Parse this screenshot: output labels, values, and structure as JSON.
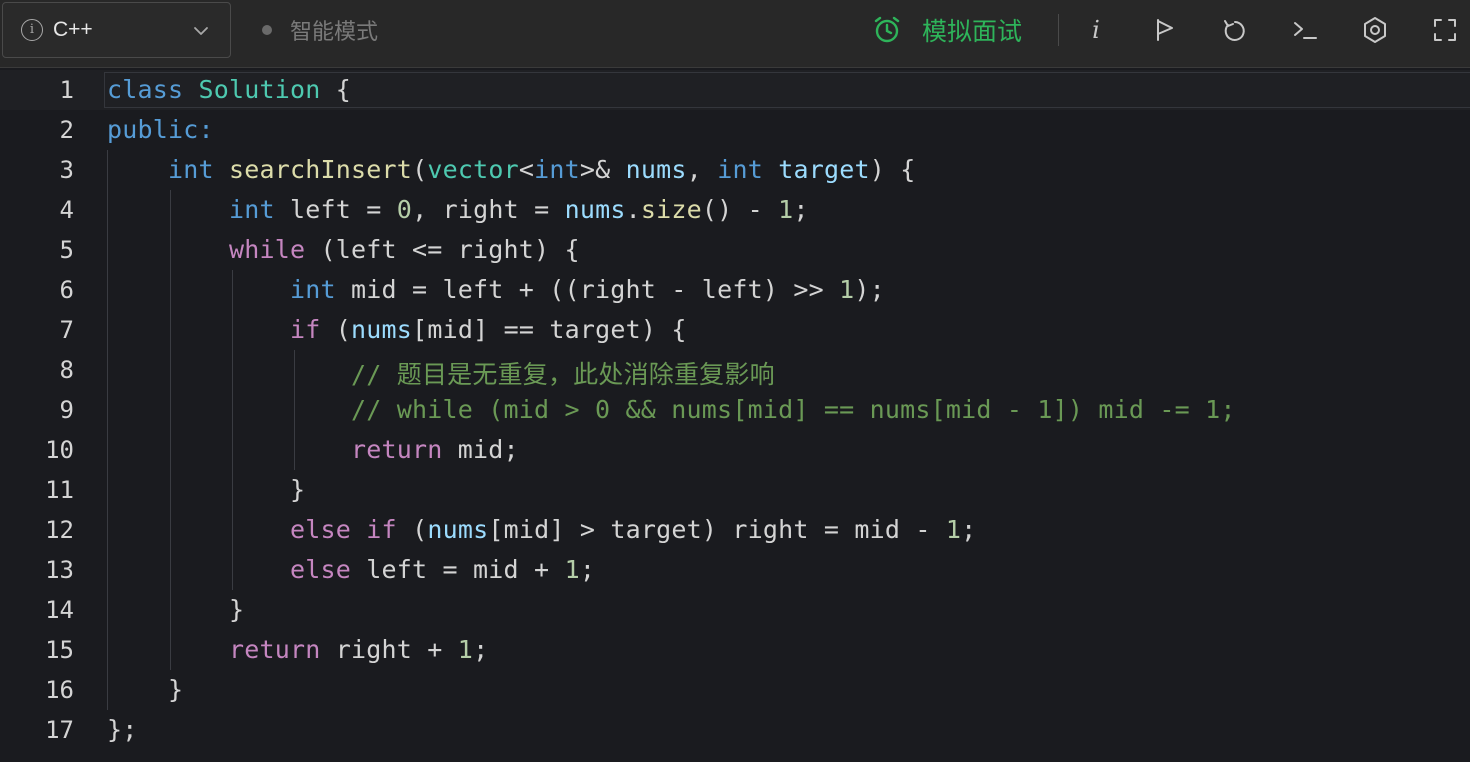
{
  "toolbar": {
    "language": "C++",
    "mode_label": "智能模式",
    "interview_label": "模拟面试",
    "accent_color": "#2eb45a",
    "icons": [
      "info-circle-icon",
      "chevron-down-icon",
      "alarm-clock-icon",
      "info-icon",
      "flag-icon",
      "reset-icon",
      "terminal-icon",
      "gear-icon",
      "fullscreen-icon"
    ]
  },
  "editor": {
    "active_line": 1,
    "lines": [
      {
        "n": "1",
        "tokens": [
          {
            "t": "class",
            "c": "kw"
          },
          {
            "t": " ",
            "c": "pl"
          },
          {
            "t": "Solution",
            "c": "ty"
          },
          {
            "t": " {",
            "c": "pl"
          }
        ]
      },
      {
        "n": "2",
        "tokens": [
          {
            "t": "public:",
            "c": "kw"
          }
        ]
      },
      {
        "n": "3",
        "tokens": [
          {
            "t": "    ",
            "c": "pl"
          },
          {
            "t": "int",
            "c": "kw"
          },
          {
            "t": " ",
            "c": "pl"
          },
          {
            "t": "searchInsert",
            "c": "fn"
          },
          {
            "t": "(",
            "c": "pl"
          },
          {
            "t": "vector",
            "c": "ty"
          },
          {
            "t": "<",
            "c": "pl"
          },
          {
            "t": "int",
            "c": "kw"
          },
          {
            "t": ">&",
            "c": "pl"
          },
          {
            "t": " ",
            "c": "pl"
          },
          {
            "t": "nums",
            "c": "var"
          },
          {
            "t": ", ",
            "c": "pl"
          },
          {
            "t": "int",
            "c": "kw"
          },
          {
            "t": " ",
            "c": "pl"
          },
          {
            "t": "target",
            "c": "var"
          },
          {
            "t": ") {",
            "c": "pl"
          }
        ]
      },
      {
        "n": "4",
        "tokens": [
          {
            "t": "        ",
            "c": "pl"
          },
          {
            "t": "int",
            "c": "kw"
          },
          {
            "t": " left = ",
            "c": "pl"
          },
          {
            "t": "0",
            "c": "num"
          },
          {
            "t": ", right = ",
            "c": "pl"
          },
          {
            "t": "nums",
            "c": "var"
          },
          {
            "t": ".",
            "c": "pl"
          },
          {
            "t": "size",
            "c": "fn"
          },
          {
            "t": "() - ",
            "c": "pl"
          },
          {
            "t": "1",
            "c": "num"
          },
          {
            "t": ";",
            "c": "pl"
          }
        ]
      },
      {
        "n": "5",
        "tokens": [
          {
            "t": "        ",
            "c": "pl"
          },
          {
            "t": "while",
            "c": "ctl"
          },
          {
            "t": " (left <= right) {",
            "c": "pl"
          }
        ]
      },
      {
        "n": "6",
        "tokens": [
          {
            "t": "            ",
            "c": "pl"
          },
          {
            "t": "int",
            "c": "kw"
          },
          {
            "t": " mid = left + ((right - left) >> ",
            "c": "pl"
          },
          {
            "t": "1",
            "c": "num"
          },
          {
            "t": ");",
            "c": "pl"
          }
        ]
      },
      {
        "n": "7",
        "tokens": [
          {
            "t": "            ",
            "c": "pl"
          },
          {
            "t": "if",
            "c": "ctl"
          },
          {
            "t": " (",
            "c": "pl"
          },
          {
            "t": "nums",
            "c": "var"
          },
          {
            "t": "[mid] == target) {",
            "c": "pl"
          }
        ]
      },
      {
        "n": "8",
        "tokens": [
          {
            "t": "                ",
            "c": "pl"
          },
          {
            "t": "// 题目是无重复，此处消除重复影响",
            "c": "cm"
          }
        ]
      },
      {
        "n": "9",
        "tokens": [
          {
            "t": "                ",
            "c": "pl"
          },
          {
            "t": "// while (mid > 0 && nums[mid] == nums[mid - 1]) mid -= 1;",
            "c": "cm"
          }
        ]
      },
      {
        "n": "10",
        "tokens": [
          {
            "t": "                ",
            "c": "pl"
          },
          {
            "t": "return",
            "c": "ctl"
          },
          {
            "t": " mid;",
            "c": "pl"
          }
        ]
      },
      {
        "n": "11",
        "tokens": [
          {
            "t": "            }",
            "c": "pl"
          }
        ]
      },
      {
        "n": "12",
        "tokens": [
          {
            "t": "            ",
            "c": "pl"
          },
          {
            "t": "else",
            "c": "ctl"
          },
          {
            "t": " ",
            "c": "pl"
          },
          {
            "t": "if",
            "c": "ctl"
          },
          {
            "t": " (",
            "c": "pl"
          },
          {
            "t": "nums",
            "c": "var"
          },
          {
            "t": "[mid] > target) right = mid - ",
            "c": "pl"
          },
          {
            "t": "1",
            "c": "num"
          },
          {
            "t": ";",
            "c": "pl"
          }
        ]
      },
      {
        "n": "13",
        "tokens": [
          {
            "t": "            ",
            "c": "pl"
          },
          {
            "t": "else",
            "c": "ctl"
          },
          {
            "t": " left = mid + ",
            "c": "pl"
          },
          {
            "t": "1",
            "c": "num"
          },
          {
            "t": ";",
            "c": "pl"
          }
        ]
      },
      {
        "n": "14",
        "tokens": [
          {
            "t": "        }",
            "c": "pl"
          }
        ]
      },
      {
        "n": "15",
        "tokens": [
          {
            "t": "        ",
            "c": "pl"
          },
          {
            "t": "return",
            "c": "ctl"
          },
          {
            "t": " right + ",
            "c": "pl"
          },
          {
            "t": "1",
            "c": "num"
          },
          {
            "t": ";",
            "c": "pl"
          }
        ]
      },
      {
        "n": "16",
        "tokens": [
          {
            "t": "    }",
            "c": "pl"
          }
        ]
      },
      {
        "n": "17",
        "tokens": [
          {
            "t": "};",
            "c": "pl"
          }
        ]
      }
    ]
  }
}
